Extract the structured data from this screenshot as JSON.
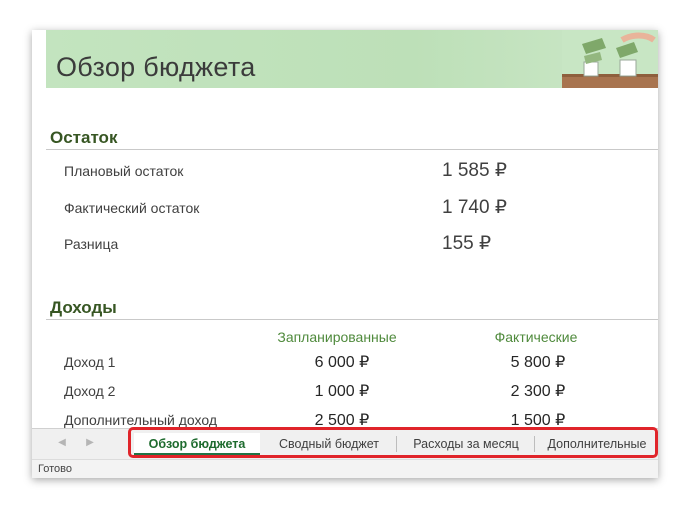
{
  "banner": {
    "title": "Обзор бюджета"
  },
  "balance": {
    "title": "Остаток",
    "rows": [
      {
        "label": "Плановый остаток",
        "value": "1 585 ₽"
      },
      {
        "label": "Фактический остаток",
        "value": "1 740 ₽"
      },
      {
        "label": "Разница",
        "value": "155 ₽"
      }
    ]
  },
  "income": {
    "title": "Доходы",
    "col_planned": "Запланированные",
    "col_actual": "Фактические",
    "rows": [
      {
        "label": "Доход 1",
        "planned": "6 000 ₽",
        "actual": "5 800 ₽"
      },
      {
        "label": "Доход 2",
        "planned": "1 000 ₽",
        "actual": "2 300 ₽"
      },
      {
        "label": "Дополнительный доход",
        "planned": "2 500 ₽",
        "actual": "1 500 ₽"
      }
    ]
  },
  "tabs": [
    {
      "label": "Обзор бюджета",
      "active": true
    },
    {
      "label": "Сводный бюджет"
    },
    {
      "label": "Расходы за месяц"
    },
    {
      "label": "Дополнительные"
    }
  ],
  "nav": {
    "prev_icon": "◀",
    "next_icon": "▶"
  },
  "status": {
    "text": "Готово"
  },
  "colors": {
    "accent": "#217346",
    "highlight": "#e0242a",
    "banner": "#c3e4bf"
  }
}
